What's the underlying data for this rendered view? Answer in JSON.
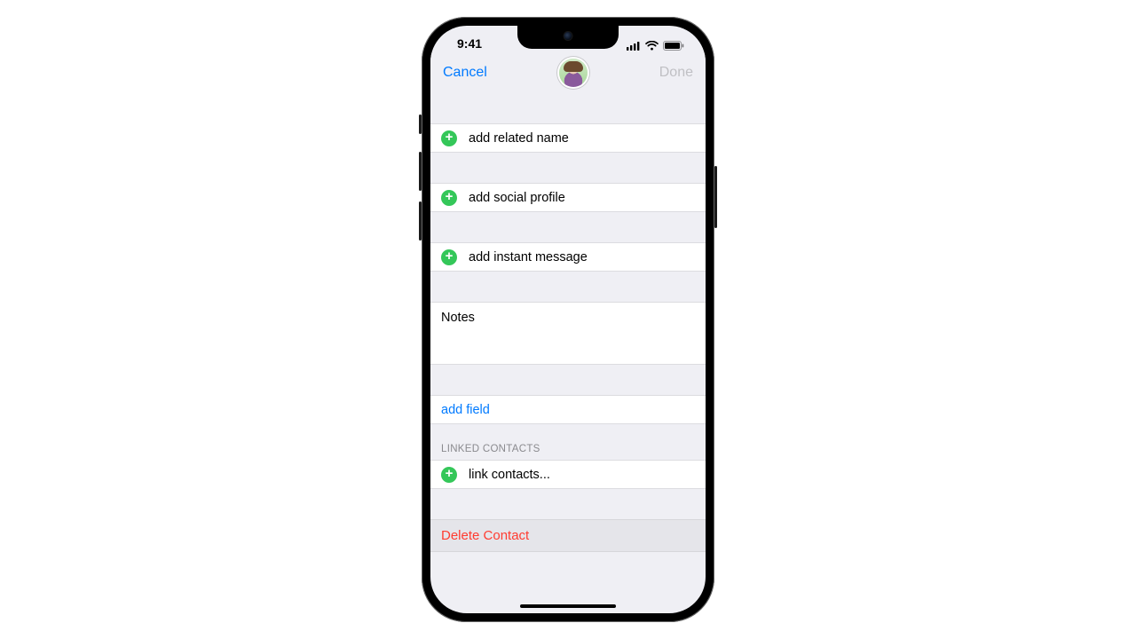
{
  "status": {
    "time": "9:41"
  },
  "nav": {
    "cancel": "Cancel",
    "done": "Done"
  },
  "rows": {
    "related_name": "add related name",
    "social_profile": "add social profile",
    "instant_message": "add instant message",
    "notes_label": "Notes",
    "add_field": "add field",
    "link_contacts": "link contacts..."
  },
  "sections": {
    "linked_contacts": "LINKED CONTACTS"
  },
  "actions": {
    "delete": "Delete Contact"
  }
}
